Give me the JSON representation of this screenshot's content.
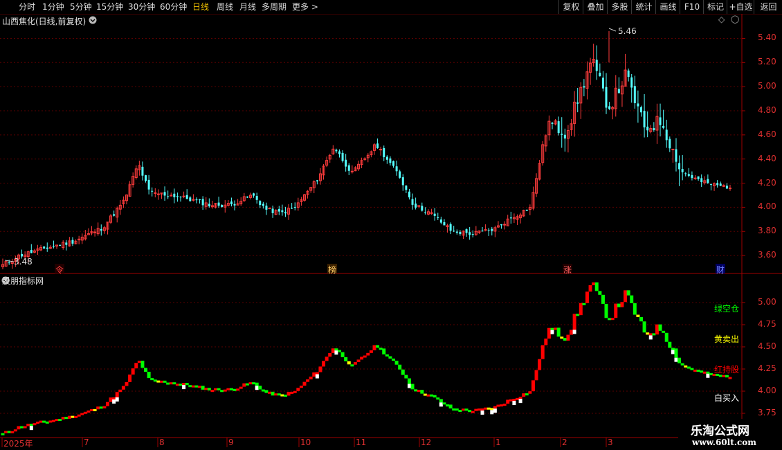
{
  "toolbar": {
    "periods": [
      "分时",
      "1分钟",
      "5分钟",
      "15分钟",
      "30分钟",
      "60分钟",
      "日线",
      "周线",
      "月线",
      "多周期",
      "更多 >"
    ],
    "active_period": "日线",
    "right_buttons": [
      "复权",
      "叠加",
      "多股",
      "统计",
      "画线",
      "F10",
      "标记",
      "+自选",
      "返回"
    ]
  },
  "main_chart": {
    "title": "山西焦化(日线,前复权)",
    "high_label": "5.46",
    "low_label": "3.48",
    "price_ticks": [
      "5.40",
      "5.20",
      "5.00",
      "4.80",
      "4.60",
      "4.40",
      "4.20",
      "4.00",
      "3.80",
      "3.60"
    ],
    "event_markers": [
      "令",
      "榜",
      "涨",
      "财"
    ]
  },
  "indicator_chart": {
    "title": "股朋指标网",
    "ticks": [
      "5.00",
      "4.75",
      "4.50",
      "4.25",
      "4.00",
      "3.75"
    ],
    "legend": [
      "绿空仓",
      "黄卖出",
      "红持股",
      "白买入"
    ]
  },
  "time_axis": [
    "2025年",
    "7",
    "8",
    "9",
    "10",
    "11",
    "12",
    "1",
    "2",
    "3"
  ],
  "watermark": {
    "line1": "乐淘公式网",
    "line2": "www.60lt.com"
  },
  "colors": {
    "up": "#ff3c3c",
    "down": "#54ffff",
    "green": "#00ff00",
    "yellow": "#ffff00",
    "white": "#ffffff",
    "red": "#ff0000"
  },
  "chart_data": {
    "type": "line",
    "title": "山西焦化(日线,前复权)",
    "ylim": [
      3.48,
      5.46
    ],
    "x": [
      "2025年",
      "7",
      "8",
      "9",
      "10",
      "11",
      "12",
      "1",
      "2",
      "3"
    ],
    "series": [
      {
        "name": "close",
        "values": [
          3.52,
          3.6,
          3.66,
          3.72,
          3.83,
          4.05,
          4.36,
          4.12,
          4.1,
          4.07,
          4.02,
          4.02,
          4.1,
          3.98,
          3.95,
          4.0,
          4.22,
          4.5,
          4.28,
          4.52,
          4.26,
          4.02,
          3.95,
          3.8,
          3.78,
          3.82,
          3.9,
          4.0,
          4.7,
          4.62,
          5.22,
          4.82,
          5.1,
          4.65,
          4.72,
          4.3,
          4.21,
          4.18,
          4.17
        ]
      }
    ]
  }
}
